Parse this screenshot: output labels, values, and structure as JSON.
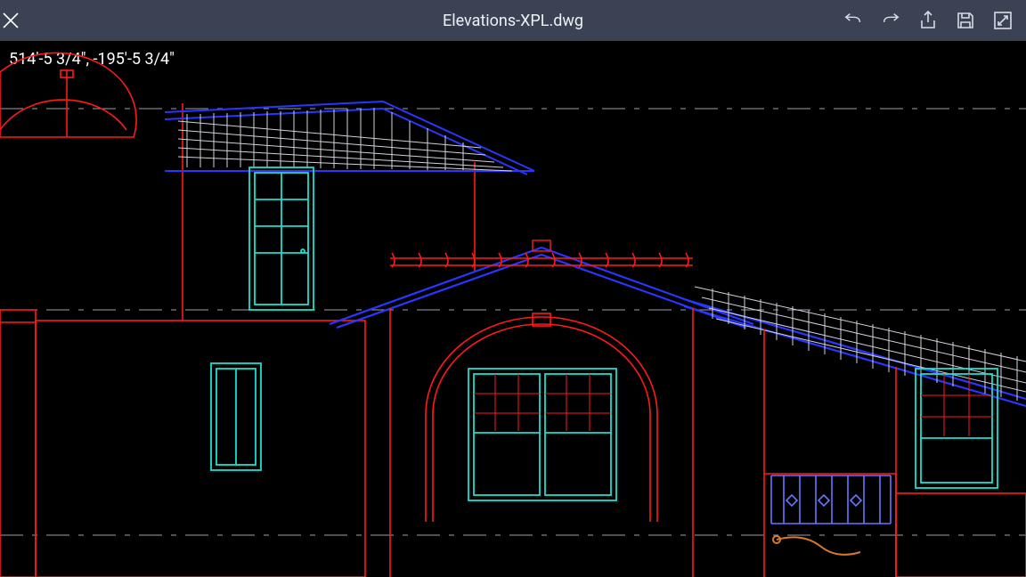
{
  "toolbar": {
    "title": "Elevations-XPL.dwg",
    "icons": {
      "close": "close-icon",
      "undo": "undo-icon",
      "redo": "redo-icon",
      "share": "share-icon",
      "save": "save-icon",
      "fullscreen": "fullscreen-icon"
    }
  },
  "viewport": {
    "coordinates": "514'-5 3/4\",  -195'-5 3/4\"",
    "layers": {
      "walls": "#ff1a1a",
      "windows": "#16e0d0",
      "roof_outline": "#2a36ff",
      "roof_hatch": "#cfd3db",
      "guide": "#9aa0aa",
      "railing": "#6b74ff"
    }
  }
}
